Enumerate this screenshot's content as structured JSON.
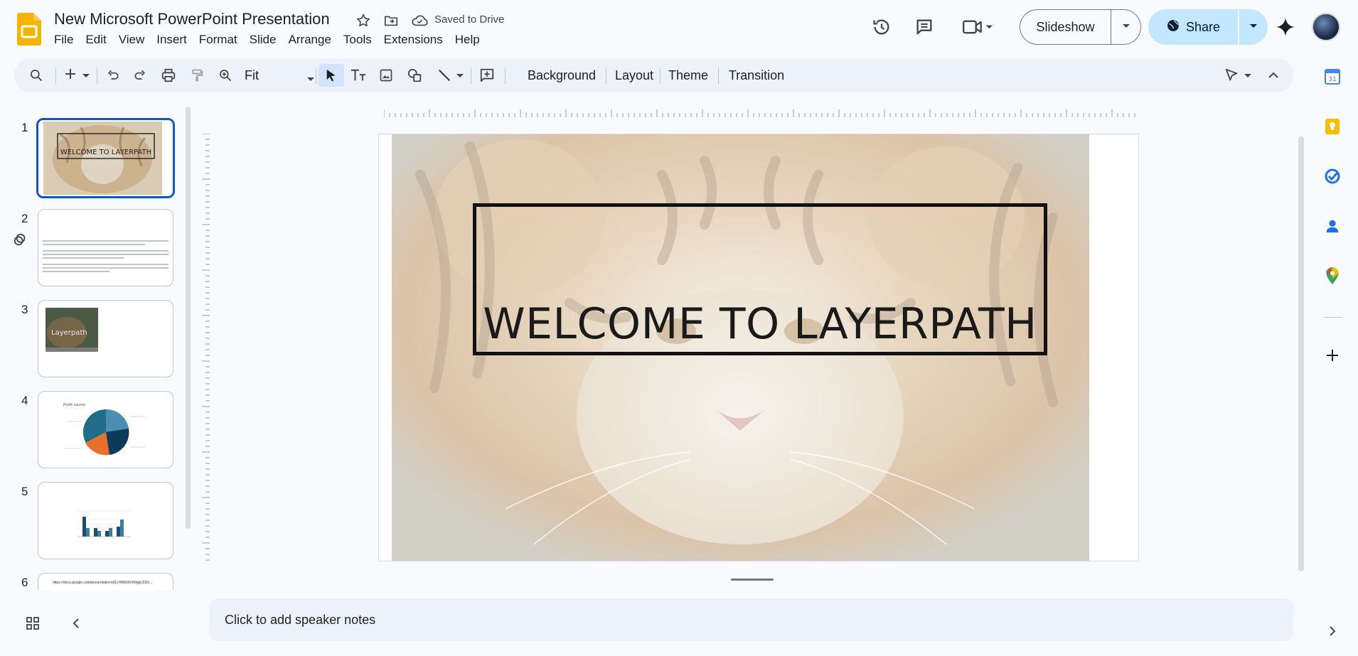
{
  "doc": {
    "title": "New Microsoft PowerPoint Presentation",
    "saved_status": "Saved to Drive"
  },
  "menu": [
    "File",
    "Edit",
    "View",
    "Insert",
    "Format",
    "Slide",
    "Arrange",
    "Tools",
    "Extensions",
    "Help"
  ],
  "header": {
    "slideshow_label": "Slideshow",
    "share_label": "Share"
  },
  "toolbar": {
    "zoom_label": "Fit",
    "background_label": "Background",
    "layout_label": "Layout",
    "theme_label": "Theme",
    "transition_label": "Transition"
  },
  "filmstrip": {
    "slides": [
      {
        "number": "1",
        "title": "WELCOME TO LAYERPATH"
      },
      {
        "number": "2"
      },
      {
        "number": "3",
        "title": "Layerpath"
      },
      {
        "number": "4",
        "title": "Profit source"
      },
      {
        "number": "5"
      },
      {
        "number": "6",
        "text": "https://docs.google.com/presentation/d/1LHR8z9VKI9gkJ23O..."
      }
    ]
  },
  "slide": {
    "title": "WELCOME TO LAYERPATH"
  },
  "notes": {
    "placeholder": "Click to add speaker notes"
  },
  "colors": {
    "accent": "#0b57d0",
    "share_bg": "#c2e7ff",
    "toolbar_bg": "#edf2fa"
  }
}
